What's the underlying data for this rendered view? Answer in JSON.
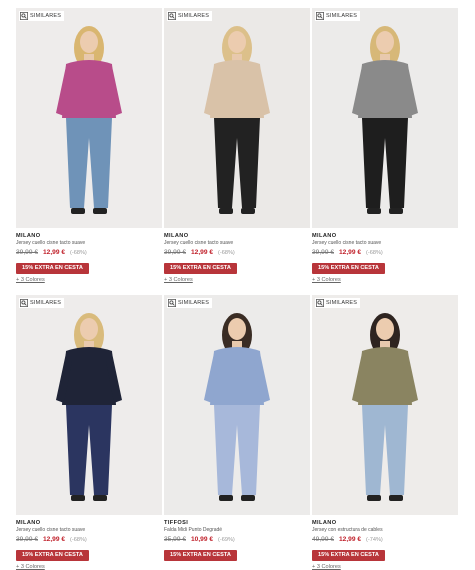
{
  "similar_label": "SIMILARES",
  "products": [
    {
      "brand": "MILANO",
      "name": "Jersey cuello cisne tacto suave",
      "old_price": "39,99 €",
      "new_price": "12,99 €",
      "discount": "(-68%)",
      "promo": "15% EXTRA EN CESTA",
      "colors": "+ 3 Colores",
      "bg": "#eeeceb",
      "garment": "#b84c8a",
      "pants": "#6f93b8",
      "hair": "#d9b670"
    },
    {
      "brand": "MILANO",
      "name": "Jersey cuello cisne tacto suave",
      "old_price": "39,99 €",
      "new_price": "12,99 €",
      "discount": "(-68%)",
      "promo": "15% EXTRA EN CESTA",
      "colors": "+ 3 Colores",
      "bg": "#ebe9e7",
      "garment": "#d9c2a8",
      "pants": "#222222",
      "hair": "#dcc08a"
    },
    {
      "brand": "MILANO",
      "name": "Jersey cuello cisne tacto suave",
      "old_price": "39,99 €",
      "new_price": "12,99 €",
      "discount": "(-68%)",
      "promo": "15% EXTRA EN CESTA",
      "colors": "+ 3 Colores",
      "bg": "#ecebea",
      "garment": "#8a8a8a",
      "pants": "#1e1e1e",
      "hair": "#d7b878"
    },
    {
      "brand": "MILANO",
      "name": "Jersey cuello cisne tacto suave",
      "old_price": "39,99 €",
      "new_price": "12,99 €",
      "discount": "(-68%)",
      "promo": "15% EXTRA EN CESTA",
      "colors": "+ 3 Colores",
      "bg": "#eeeceb",
      "garment": "#1f2437",
      "pants": "#2b3560",
      "hair": "#d9bb7c"
    },
    {
      "brand": "TIFFOSI",
      "name": "Falda Midi Punto Degradé",
      "old_price": "35,99 €",
      "new_price": "10,99 €",
      "discount": "(-69%)",
      "promo": "15% EXTRA EN CESTA",
      "colors": "",
      "bg": "#ecebea",
      "garment": "#8fa6cf",
      "pants": "#a7b8da",
      "hair": "#3a2c24"
    },
    {
      "brand": "MILANO",
      "name": "Jersey con estructura de cables",
      "old_price": "49,99 €",
      "new_price": "12,99 €",
      "discount": "(-74%)",
      "promo": "15% EXTRA EN CESTA",
      "colors": "+ 3 Colores",
      "bg": "#eeecea",
      "garment": "#8a8461",
      "pants": "#9fb7d2",
      "hair": "#2e2420"
    }
  ]
}
